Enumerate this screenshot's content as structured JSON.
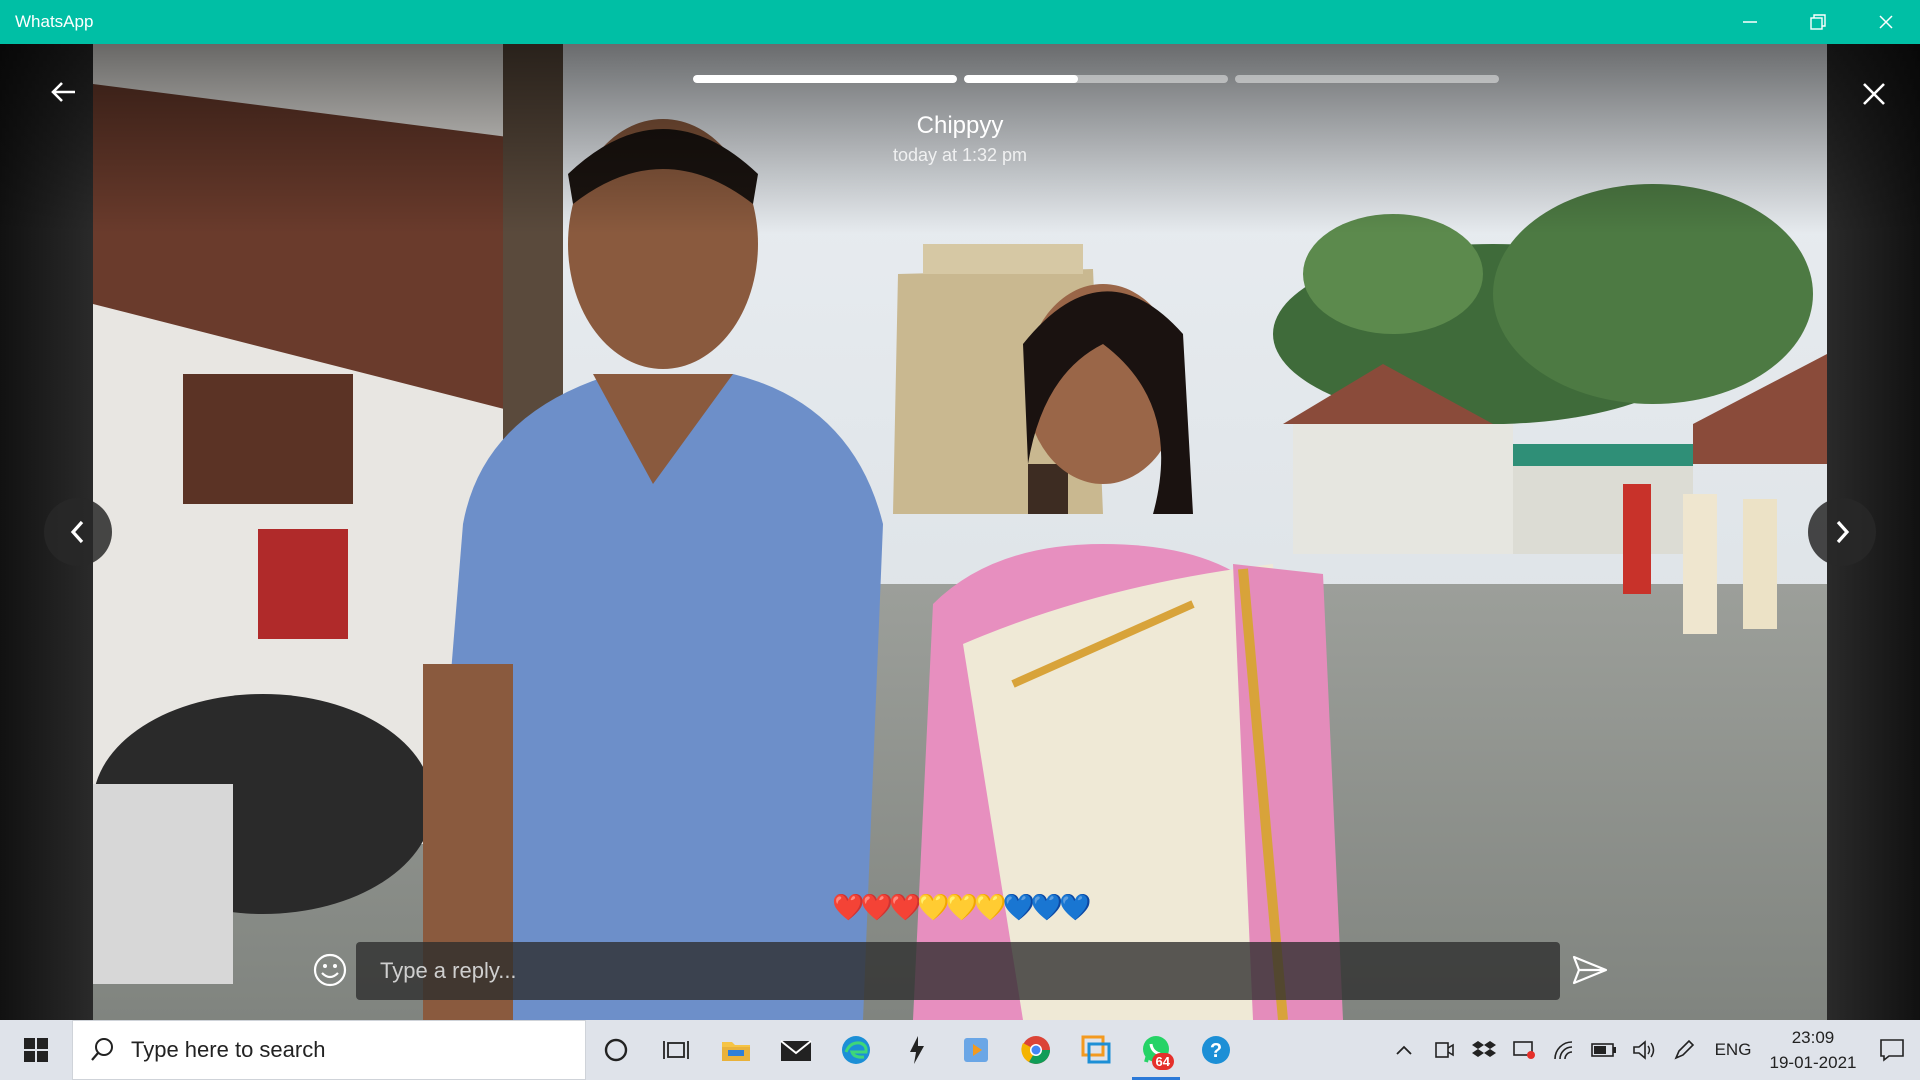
{
  "window": {
    "title": "WhatsApp"
  },
  "status_viewer": {
    "sender": "Chippyy",
    "timestamp": "today at 1:32 pm",
    "progress": [
      1.0,
      0.43,
      0.0
    ],
    "caption": "❤️❤️❤️💛💛💛💙💙💙",
    "reply_placeholder": "Type a reply..."
  },
  "taskbar": {
    "search_placeholder": "Type here to search",
    "whatsapp_badge": "64",
    "language": "ENG",
    "time": "23:09",
    "date": "19-01-2021",
    "icons": [
      "cortana-icon",
      "task-view-icon",
      "file-explorer-icon",
      "mail-icon",
      "edge-icon",
      "app-icon",
      "media-icon",
      "chrome-icon",
      "remote-icon",
      "whatsapp-icon",
      "help-icon"
    ]
  },
  "colors": {
    "accent": "#00bfa5",
    "taskbar": "#dfe3ea",
    "badge": "#e5302b"
  }
}
